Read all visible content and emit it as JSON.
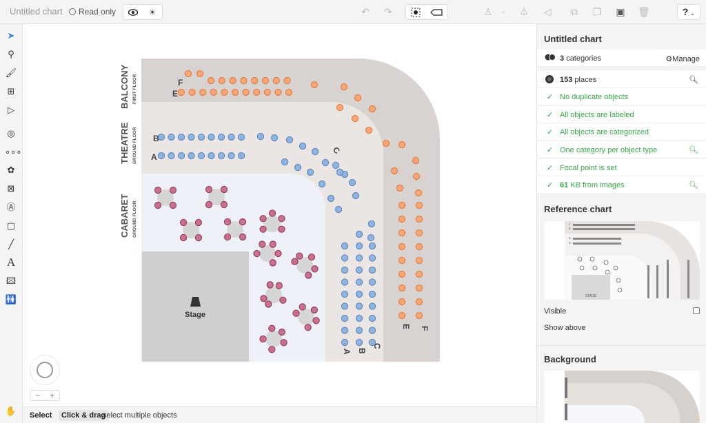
{
  "toolbar": {
    "title": "Untitled chart",
    "read_only_label": "Read only",
    "help_label": "?"
  },
  "canvas": {
    "sections": [
      {
        "title": "BALCONY",
        "subtitle": "FIRST FLOOR"
      },
      {
        "title": "THEATRE",
        "subtitle": "GROUND FLOOR"
      },
      {
        "title": "CABARET",
        "subtitle": "GROUND FLOOR"
      }
    ],
    "row_labels_top": [
      "F",
      "E",
      "B",
      "A",
      "C"
    ],
    "row_labels_right": [
      "A",
      "B",
      "C",
      "E",
      "F"
    ],
    "stage_label": "Stage",
    "colors": {
      "balcony": "#f5a77a",
      "theatre": "#8fb4e0",
      "cabaret": "#c9708e",
      "hall": "#d8d3d0",
      "inner": "#ebe6e3",
      "cabaret_floor": "#eef1f8",
      "stage": "#cfcfd1"
    }
  },
  "statusbar": {
    "mode": "Select",
    "hint_key": "Click & drag",
    "hint_text": "select multiple objects"
  },
  "zoom": {
    "minus": "−",
    "plus": "+"
  },
  "panel": {
    "title": "Untitled chart",
    "categories_count": "3",
    "categories_label": "categories",
    "manage_label": "Manage",
    "places_count": "153",
    "places_label": "places",
    "checks": [
      "No duplicate objects",
      "All objects are labeled",
      "All objects are categorized",
      "One category per object type",
      "Focal point is set"
    ],
    "images_size": "61",
    "images_label": "KB from images",
    "reference_title": "Reference chart",
    "visible_label": "Visible",
    "show_above_label": "Show above",
    "background_title": "Background"
  }
}
